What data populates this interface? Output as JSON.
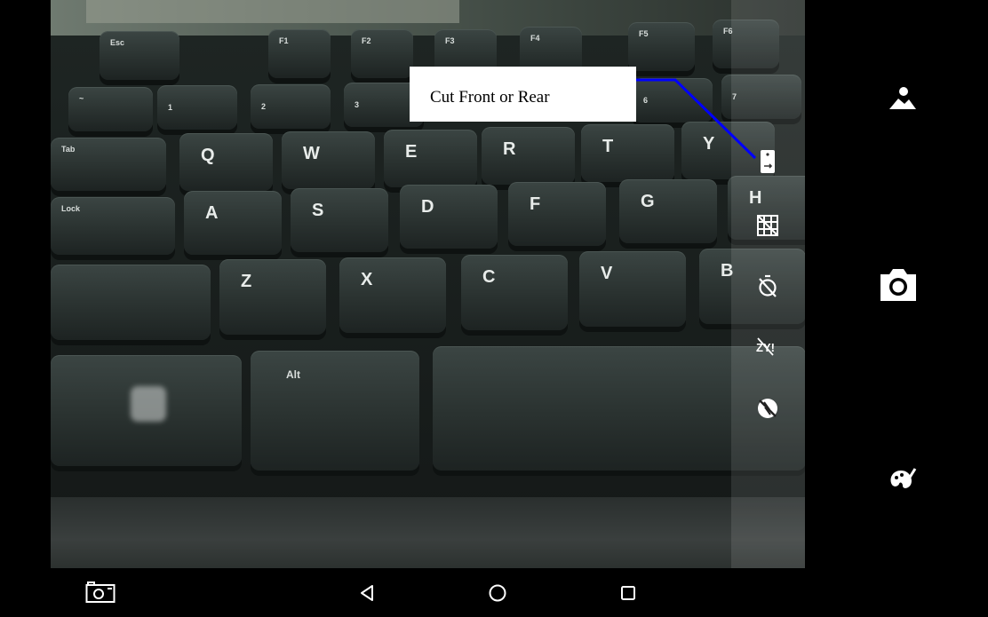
{
  "tooltip": {
    "text": "Cut Front or Rear"
  },
  "accent_color": "#0000ff",
  "keys": {
    "esc": "Esc",
    "f1": "F1",
    "f2": "F2",
    "f3": "F3",
    "f4": "F4",
    "f5": "F5",
    "f6": "F6",
    "tilde": "~",
    "one": "1",
    "two": "2",
    "three": "3",
    "six": "6",
    "seven": "7",
    "tab": "Tab",
    "q": "Q",
    "w": "W",
    "e": "E",
    "r": "R",
    "t": "T",
    "y": "Y",
    "lock": "Lock",
    "a": "A",
    "s": "S",
    "d": "D",
    "f": "F",
    "g": "G",
    "h": "H",
    "z": "Z",
    "x": "X",
    "c": "C",
    "v": "V",
    "b": "B",
    "alt": "Alt"
  },
  "settings_icons": [
    "switch-camera-icon",
    "grid-icon",
    "timer-off-icon",
    "hdr-off-icon",
    "flash-off-icon"
  ],
  "panel_icons": [
    "gallery-icon",
    "shutter-icon",
    "filters-icon"
  ],
  "nav_icons": [
    "screenshot-icon",
    "back-icon",
    "home-icon",
    "recents-icon"
  ]
}
